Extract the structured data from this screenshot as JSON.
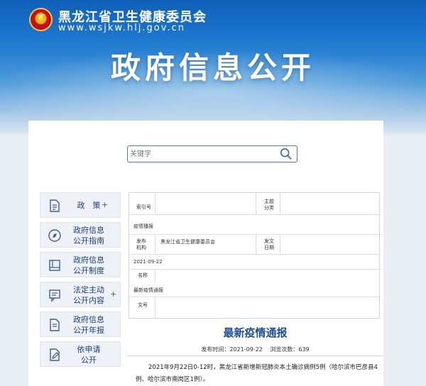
{
  "header": {
    "org_name": "黑龙江省卫生健康委员会",
    "url": "www.wsjkw.hlj.gov.cn",
    "title": "政府信息公开"
  },
  "search": {
    "placeholder": "关键字"
  },
  "menu": {
    "items": [
      {
        "line1": "政　策",
        "line2": "",
        "plus": "+",
        "icon": "document-icon"
      },
      {
        "line1": "政府信息",
        "line2": "公开指南",
        "plus": "",
        "icon": "compass-icon"
      },
      {
        "line1": "政府信息",
        "line2": "公开制度",
        "plus": "",
        "icon": "book-icon"
      },
      {
        "line1": "法定主动",
        "line2": "公开内容",
        "plus": "+",
        "icon": "message-icon"
      },
      {
        "line1": "政府信息",
        "line2": "公开年报",
        "plus": "",
        "icon": "report-icon"
      },
      {
        "line1": "依申请",
        "line2": "公开",
        "plus": "",
        "icon": "edit-document-icon"
      }
    ]
  },
  "meta": {
    "index_label": "索引号",
    "category_label": "主题分类",
    "category_value": "疫情播报",
    "publisher_label": "发布机构",
    "publisher_value": "黑龙江省卫生健康委员会",
    "date_label": "发文日期",
    "date_value": "2021-09-22",
    "name_label": "名称",
    "name_value": "最新疫情通报",
    "doc_no_label": "文号"
  },
  "article": {
    "title": "最新疫情通报",
    "publish_time": "发布时间：2021-09-22",
    "views": "浏览次数：639",
    "body": "2021年9月22日0-12时，黑龙江省新增新冠肺炎本土确诊病例5例（哈尔滨市巴彦县4例、哈尔滨市南岗区1例）。"
  },
  "colors": {
    "accent": "#1f4e92",
    "header_top": "#0f5fb8"
  }
}
